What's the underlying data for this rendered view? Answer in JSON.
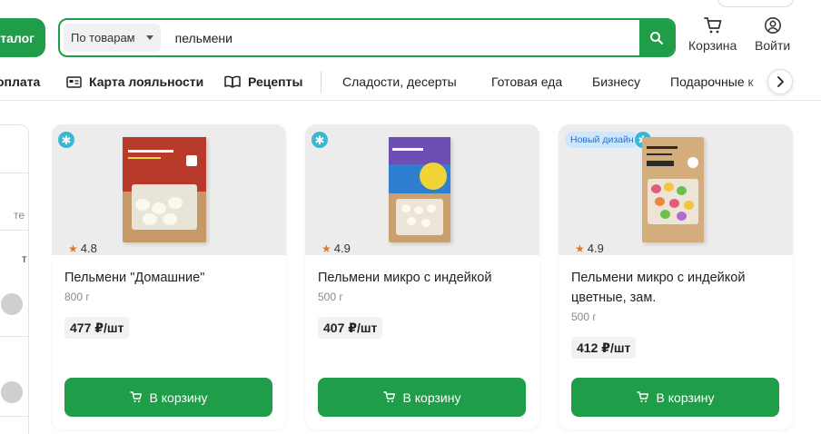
{
  "colors": {
    "brand_green": "#1f9d49",
    "snow_badge": "#3ab7d4",
    "rating_star": "#e07a20"
  },
  "header": {
    "catalog_label": "талог",
    "search": {
      "scope_label": "По товарам",
      "query": "пельмени"
    },
    "cart_label": "Корзина",
    "login_label": "Войти"
  },
  "nav": {
    "items": [
      "оплата",
      "Карта лояльности",
      "Рецепты",
      "Сладости, десерты",
      "Готовая еда",
      "Бизнесу",
      "Подарочные к"
    ]
  },
  "filters": {
    "partial_text_1": "те",
    "partial_text_2": "т"
  },
  "products": [
    {
      "badge": "",
      "rating": "4.8",
      "title": "Пельмени \"Домашние\"",
      "weight": "800 г",
      "price": "477 ₽/шт",
      "button": "В корзину"
    },
    {
      "badge": "",
      "rating": "4.9",
      "title": "Пельмени микро с индейкой",
      "weight": "500 г",
      "price": "407 ₽/шт",
      "button": "В корзину"
    },
    {
      "badge": "Новый дизайн",
      "rating": "4.9",
      "title": "Пельмени микро с индейкой цветные, зам.",
      "weight": "500 г",
      "price": "412 ₽/шт",
      "button": "В корзину"
    }
  ],
  "icons": {
    "search": "search-icon",
    "cart": "cart-icon",
    "user": "user-icon",
    "loyalty_card": "card-icon",
    "recipes": "book-icon",
    "chevron": "chevron-right-icon",
    "snowflake": "snowflake-icon"
  }
}
